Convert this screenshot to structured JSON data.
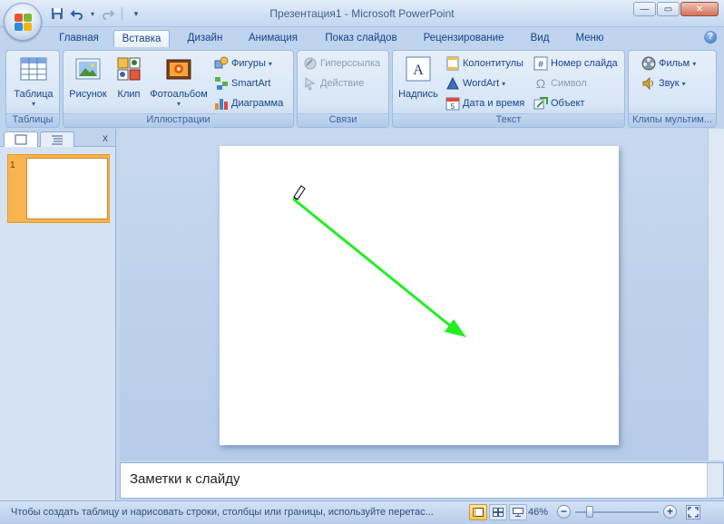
{
  "window": {
    "title": "Презентация1 - Microsoft PowerPoint"
  },
  "qat": {
    "icons": [
      "save-icon",
      "undo-icon",
      "redo-icon",
      "customize-icon"
    ]
  },
  "tabs": [
    {
      "label": "Главная"
    },
    {
      "label": "Вставка",
      "active": true
    },
    {
      "label": "Дизайн"
    },
    {
      "label": "Анимация"
    },
    {
      "label": "Показ слайдов"
    },
    {
      "label": "Рецензирование"
    },
    {
      "label": "Вид"
    },
    {
      "label": "Меню"
    }
  ],
  "ribbon": {
    "tables": {
      "label": "Таблицы",
      "table": "Таблица"
    },
    "illustrations": {
      "label": "Иллюстрации",
      "picture": "Рисунок",
      "clip": "Клип",
      "album": "Фотоальбом",
      "shapes": "Фигуры",
      "smartart": "SmartArt",
      "chart": "Диаграмма"
    },
    "links": {
      "label": "Связи",
      "hyperlink": "Гиперссылка",
      "action": "Действие"
    },
    "text": {
      "label": "Текст",
      "textbox": "Надпись",
      "header_footer": "Колонтитулы",
      "wordart": "WordArt",
      "datetime": "Дата и время",
      "slide_number": "Номер слайда",
      "symbol": "Символ",
      "object": "Объект"
    },
    "media": {
      "label": "Клипы мультим...",
      "movie": "Фильм",
      "sound": "Звук"
    }
  },
  "slides_panel": {
    "slide_number": "1",
    "close": "x"
  },
  "notes": {
    "placeholder": "Заметки к слайду"
  },
  "status": {
    "text": "Чтобы создать таблицу и нарисовать строки, столбцы или границы, используйте перетас...",
    "zoom": "46%",
    "zoom_level": 0.46
  },
  "colors": {
    "arrow": "#22ee22",
    "thumb_highlight": "#f9b450",
    "ribbon": "#bfd4ee"
  }
}
